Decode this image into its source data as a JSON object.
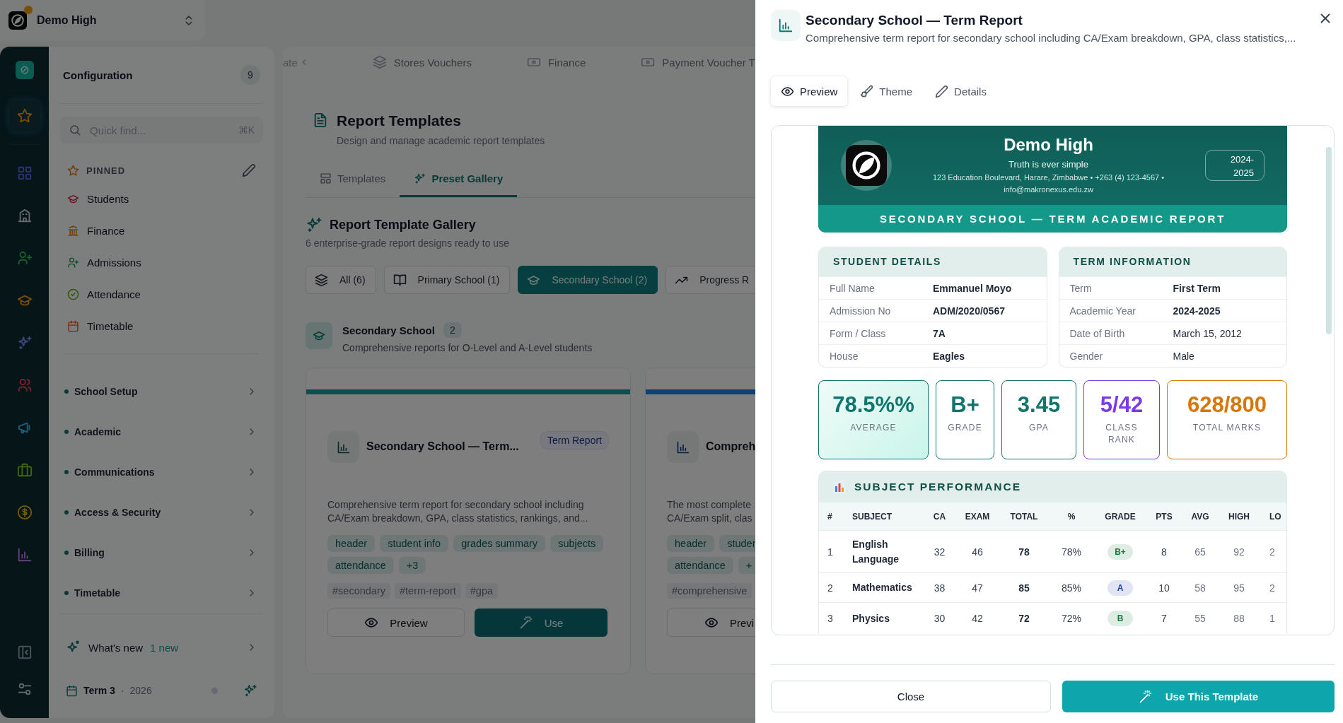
{
  "brand": {
    "name": "Demo High",
    "notification": true
  },
  "rail": [
    {
      "selected": true
    },
    {
      "selected": false
    },
    {
      "selected": false
    },
    {
      "selected": false
    },
    {
      "selected": false
    },
    {
      "selected": false
    },
    {
      "selected": false
    },
    {
      "selected": false
    },
    {
      "selected": false
    },
    {
      "selected": false
    },
    {
      "selected": false
    }
  ],
  "config": {
    "title": "Configuration",
    "count": "9",
    "search": {
      "placeholder": "Quick find...",
      "shortcut": "⌘K"
    },
    "pinned_label": "PINNED",
    "pinned": [
      "Students",
      "Finance",
      "Admissions",
      "Attendance",
      "Timetable"
    ],
    "sections": [
      "School Setup",
      "Academic",
      "Communications",
      "Access & Security",
      "Billing",
      "Timetable"
    ],
    "whats_new": {
      "label": "What's new",
      "badge": "1 new"
    },
    "term": {
      "name": "Term 3",
      "separator": "·",
      "year": "2026"
    }
  },
  "top_tabs": [
    "ate",
    "Stores Vouchers",
    "Finance",
    "Payment Voucher T"
  ],
  "page": {
    "title": "Report Templates",
    "subtitle": "Design and manage academic report templates"
  },
  "view_tabs": [
    {
      "label": "Templates",
      "selected": false
    },
    {
      "label": "Preset Gallery",
      "selected": true
    }
  ],
  "gallery": {
    "title": "Report Template Gallery",
    "subtitle": "6 enterprise-grade report designs ready to use",
    "filters": [
      {
        "label": "All (6)",
        "selected": false
      },
      {
        "label": "Primary School (1)",
        "selected": false
      },
      {
        "label": "Secondary School (2)",
        "selected": true
      },
      {
        "label": "Progress R",
        "selected": false
      }
    ],
    "section": {
      "title": "Secondary School",
      "count": "2",
      "description": "Comprehensive reports for O-Level and A-Level students"
    },
    "cards": [
      {
        "color": "#0e4f4b",
        "title": "Secondary School — Term...",
        "badge": "Term Report",
        "description": "Comprehensive term report for secondary school including\nCA/Exam breakdown, GPA, class statistics, rankings, and...",
        "sections": [
          "header",
          "student info",
          "grades summary",
          "subjects",
          "attendance",
          "+3"
        ],
        "tags": [
          "#secondary",
          "#term-report",
          "#gpa"
        ],
        "preview": "Preview",
        "use": "Use"
      },
      {
        "color": "#123f73",
        "title": "Compreh",
        "description": "The most complete\nCA/Exam split, clas",
        "sections": [
          "header",
          "studer",
          "attendance",
          "+"
        ],
        "tags": [
          "#comprehensive"
        ],
        "preview": "Previ"
      }
    ]
  },
  "drawer": {
    "title": "Secondary School — Term Report",
    "subtitle": "Comprehensive term report for secondary school including CA/Exam breakdown, GPA, class statistics,...",
    "tabs": [
      {
        "label": "Preview",
        "selected": true
      },
      {
        "label": "Theme",
        "selected": false
      },
      {
        "label": "Details",
        "selected": false
      }
    ],
    "report": {
      "school": "Demo High",
      "motto": "Truth is ever simple",
      "contact": "123 Education Boulevard, Harare, Zimbabwe • +263 (4) 123-4567 • info@makronexus.edu.zw",
      "year": "2024-2025",
      "title": "SECONDARY SCHOOL — TERM ACADEMIC REPORT",
      "panels": [
        {
          "title": "STUDENT DETAILS",
          "rows": [
            {
              "label": "Full Name",
              "value": "Emmanuel Moyo",
              "bold": true
            },
            {
              "label": "Admission No",
              "value": "ADM/2020/0567",
              "bold": true
            },
            {
              "label": "Form / Class",
              "value": "7A",
              "bold": true
            },
            {
              "label": "House",
              "value": "Eagles",
              "bold": true
            }
          ]
        },
        {
          "title": "TERM INFORMATION",
          "rows": [
            {
              "label": "Term",
              "value": "First Term",
              "bold": true
            },
            {
              "label": "Academic Year",
              "value": "2024-2025",
              "bold": true
            },
            {
              "label": "Date of Birth",
              "value": "March 15, 2012",
              "bold": false
            },
            {
              "label": "Gender",
              "value": "Male",
              "bold": false
            }
          ]
        }
      ],
      "stats": [
        {
          "value": "78.5%%",
          "label": "AVERAGE",
          "color": "#0f766e",
          "highlight": true
        },
        {
          "value": "B+",
          "label": "GRADE",
          "color": "#0f766e",
          "highlight": false
        },
        {
          "value": "3.45",
          "label": "GPA",
          "color": "#0f766e",
          "highlight": false
        },
        {
          "value": "5/42",
          "label": "CLASS RANK",
          "color": "#7c3aed",
          "highlight": false
        },
        {
          "value": "628/800",
          "label": "TOTAL MARKS",
          "color": "#d97706",
          "highlight": false
        }
      ],
      "subjects": {
        "title": "SUBJECT PERFORMANCE",
        "columns": [
          "#",
          "SUBJECT",
          "CA",
          "EXAM",
          "TOTAL",
          "%",
          "GRADE",
          "PTS",
          "AVG",
          "HIGH",
          "LO"
        ],
        "rows": [
          {
            "cells": [
              "1",
              "English Language",
              "32",
              "46",
              "78",
              "78%",
              {
                "text": "B+",
                "color": "#15803d"
              },
              "8",
              "65",
              "92",
              "2"
            ]
          },
          {
            "cells": [
              "2",
              "Mathematics",
              "38",
              "47",
              "85",
              "85%",
              {
                "text": "A",
                "color": "#1e40af"
              },
              "10",
              "58",
              "95",
              "2"
            ]
          },
          {
            "cells": [
              "3",
              "Physics",
              "30",
              "42",
              "72",
              "72%",
              {
                "text": "B",
                "color": "#15803d"
              },
              "7",
              "55",
              "88",
              "1"
            ]
          }
        ]
      }
    },
    "close": "Close",
    "use": "Use This Template"
  }
}
